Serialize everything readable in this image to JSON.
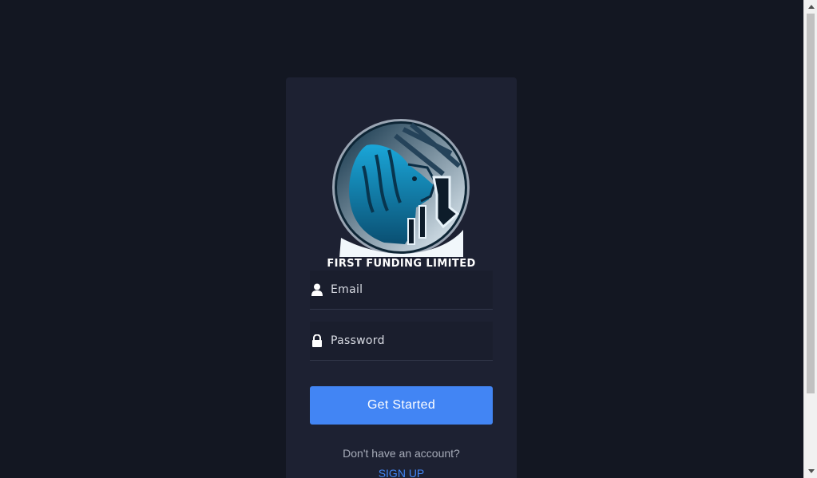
{
  "brand": {
    "name": "FIRST FUNDING LIMITED"
  },
  "login_form": {
    "email_placeholder": "Email",
    "password_placeholder": "Password",
    "submit_label": "Get Started",
    "signup_prompt": "Don't have an account?",
    "signup_link": "SIGN UP"
  },
  "icons": {
    "email": "user-icon",
    "password": "lock-icon"
  },
  "colors": {
    "page_background": "#131722",
    "card_background": "#1d2132",
    "accent": "#4285f4"
  }
}
